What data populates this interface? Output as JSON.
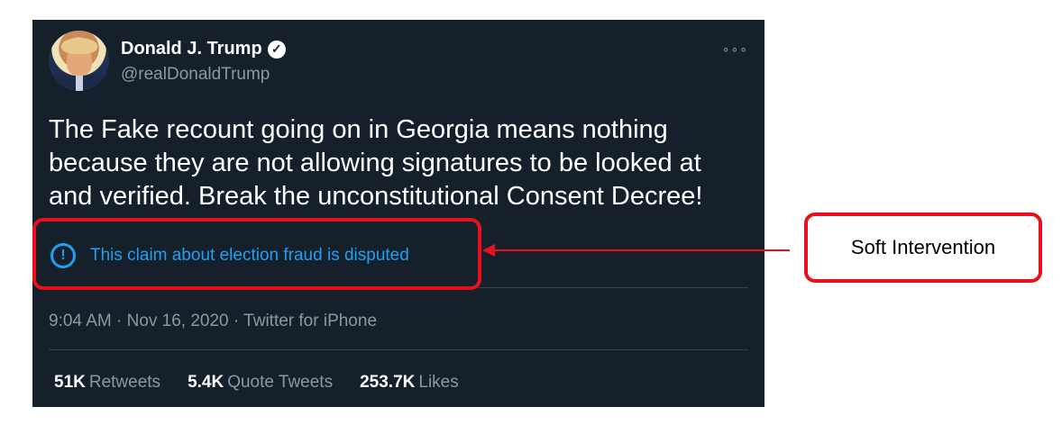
{
  "tweet": {
    "display_name": "Donald J. Trump",
    "handle": "@realDonaldTrump",
    "verified_glyph": "✓",
    "more_glyph": "∘∘∘",
    "text": "The Fake recount going on in Georgia means nothing because they are not allowing signatures to be looked at and verified. Break the unconstitutional Consent Decree!",
    "notice": {
      "icon_glyph": "!",
      "label": "This claim about election fraud is disputed"
    },
    "meta": "9:04 AM · Nov 16, 2020 · Twitter for iPhone",
    "stats": [
      {
        "count": "51K",
        "label": "Retweets"
      },
      {
        "count": "5.4K",
        "label": "Quote Tweets"
      },
      {
        "count": "253.7K",
        "label": "Likes"
      }
    ]
  },
  "annotation": {
    "callout_label": "Soft Intervention"
  },
  "colors": {
    "card_bg": "#15202b",
    "accent_blue": "#1da1f2",
    "annotation_red": "#e8101e",
    "muted_text": "#8899a6"
  }
}
